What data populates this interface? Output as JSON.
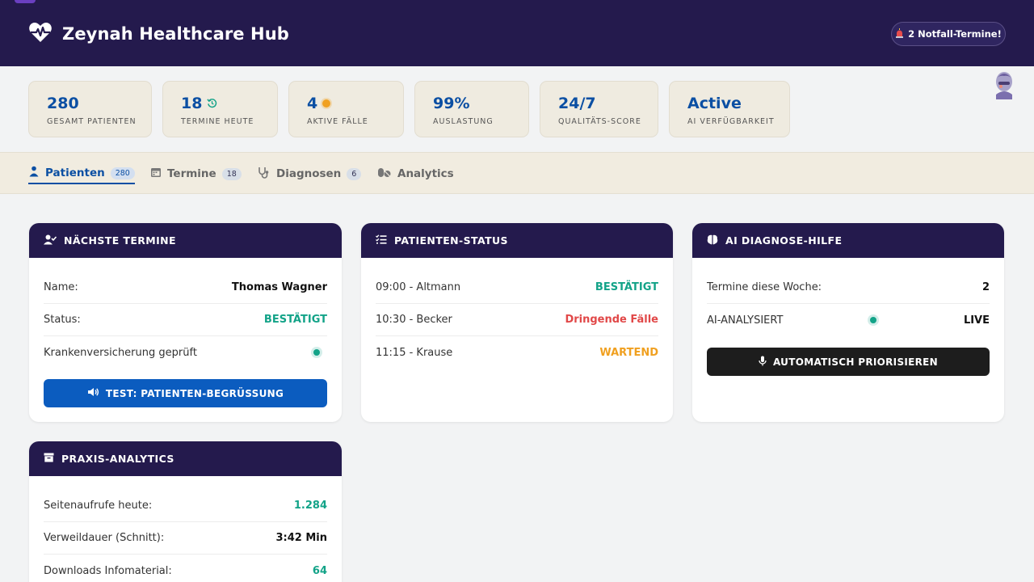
{
  "header": {
    "title": "Zeynah Healthcare Hub",
    "emergency_badge": "2 Notfall-Termine!"
  },
  "stats": [
    {
      "value": "280",
      "label": "GESAMT PATIENTEN"
    },
    {
      "value": "18",
      "label": "TERMINE HEUTE"
    },
    {
      "value": "4",
      "label": "AKTIVE FÄLLE"
    },
    {
      "value": "99%",
      "label": "AUSLASTUNG"
    },
    {
      "value": "24/7",
      "label": "QUALITÄTS-SCORE"
    },
    {
      "value": "Active",
      "label": "AI VERFÜGBARKEIT"
    }
  ],
  "tabs": [
    {
      "label": "Patienten",
      "count": "280",
      "icon": "patient-icon"
    },
    {
      "label": "Termine",
      "count": "18",
      "icon": "calendar-icon"
    },
    {
      "label": "Diagnosen",
      "count": "6",
      "icon": "stethoscope-icon"
    },
    {
      "label": "Analytics",
      "icon": "pills-icon"
    }
  ],
  "appointments": {
    "title": "NÄCHSTE TERMINE",
    "name_label": "Name:",
    "name_value": "Thomas Wagner",
    "status_label": "Status:",
    "status_value": "BESTÄTIGT",
    "insurance_label": "Krankenversicherung geprüft",
    "button": "TEST: PATIENTEN-BEGRÜSSUNG"
  },
  "patient_status": {
    "title": "PATIENTEN-STATUS",
    "rows": [
      {
        "time": "09:00 - Altmann",
        "status": "BESTÄTIGT"
      },
      {
        "time": "10:30 - Becker",
        "status": "Dringende Fälle"
      },
      {
        "time": "11:15 - Krause",
        "status": "WARTEND"
      }
    ]
  },
  "ai": {
    "title": "AI DIAGNOSE-HILFE",
    "week_label": "Termine diese Woche:",
    "week_value": "2",
    "analyzed_label": "AI-ANALYSIERT",
    "analyzed_value": "LIVE",
    "button": "AUTOMATISCH PRIORISIEREN"
  },
  "analytics": {
    "title": "PRAXIS-ANALYTICS",
    "views_label": "Seitenaufrufe heute:",
    "views_value": "1.284",
    "duration_label": "Verweildauer (Schnitt):",
    "duration_value": "3:42 Min",
    "downloads_label": "Downloads Infomaterial:",
    "downloads_value": "64"
  },
  "colors": {
    "header_bg": "#241a4d",
    "accent_blue": "#0b4fa3",
    "success": "#13a388",
    "danger": "#e14848",
    "warning": "#f0a020"
  }
}
